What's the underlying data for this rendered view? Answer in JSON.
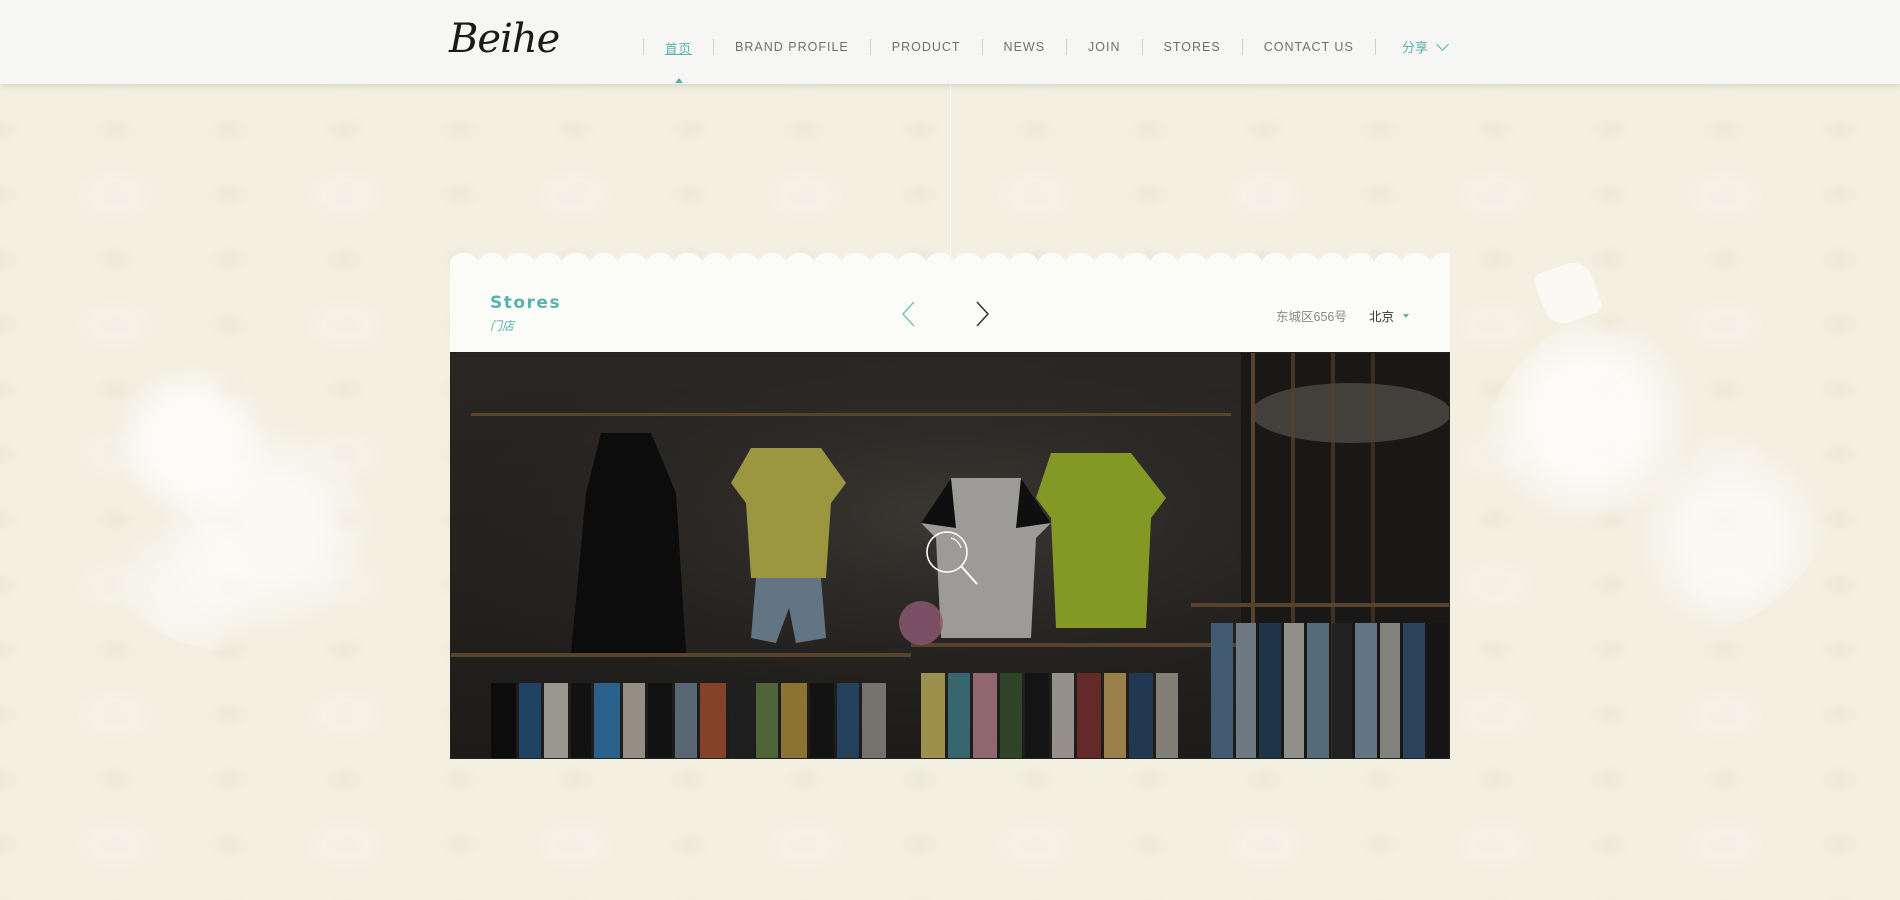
{
  "header": {
    "logo": "Beihe",
    "nav": [
      {
        "label": "首页",
        "active": true
      },
      {
        "label": "BRAND PROFILE",
        "active": false
      },
      {
        "label": "PRODUCT",
        "active": false
      },
      {
        "label": "NEWS",
        "active": false
      },
      {
        "label": "JOIN",
        "active": false
      },
      {
        "label": "STORES",
        "active": false
      },
      {
        "label": "CONTACT US",
        "active": false
      }
    ],
    "share_label": "分享"
  },
  "stores": {
    "title": "Stores",
    "subtitle": "门店",
    "address": "东城区656号",
    "city": "北京"
  },
  "icons": {
    "prev": "chevron-left-icon",
    "next": "chevron-right-icon",
    "zoom": "magnifier-icon",
    "share": "chevron-down-icon",
    "city": "caret-down-icon"
  },
  "colors": {
    "accent": "#5ab2ad",
    "background": "#f3efe1",
    "header_bg": "#f6f6f4"
  }
}
